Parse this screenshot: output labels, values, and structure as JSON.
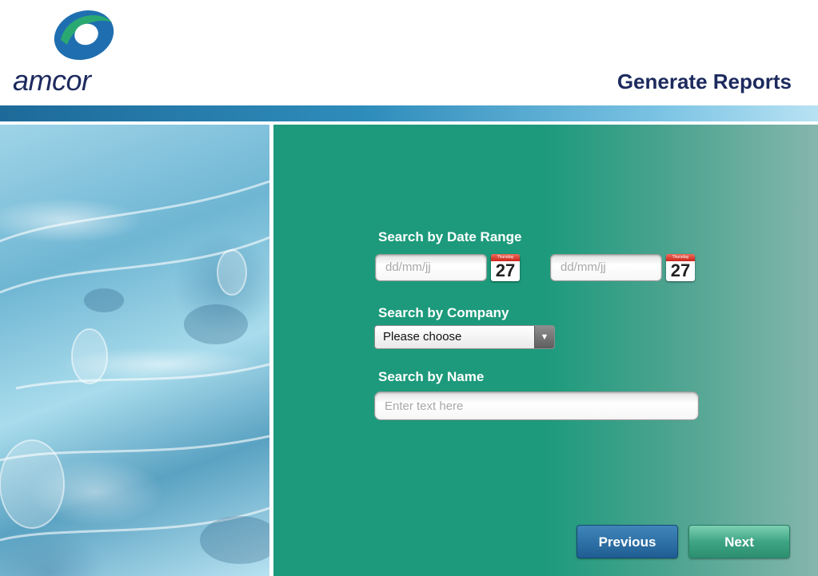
{
  "brand": {
    "name": "amcor",
    "colors": {
      "navy": "#1c2a5e",
      "green": "#2aa872",
      "blue": "#1f6fb0",
      "panel": "#1d9a7c"
    }
  },
  "header": {
    "title": "Generate Reports"
  },
  "form": {
    "date_range": {
      "label": "Search by Date Range",
      "from": {
        "placeholder": "dd/mm/jj",
        "calendar_day": "27",
        "calendar_weekday": "Thursday"
      },
      "to": {
        "placeholder": "dd/mm/jj",
        "calendar_day": "27",
        "calendar_weekday": "Thursday"
      }
    },
    "company": {
      "label": "Search by Company",
      "selected": "Please choose",
      "arrow": "▼"
    },
    "name": {
      "label": "Search by Name",
      "placeholder": "Enter text here"
    }
  },
  "footer": {
    "previous_label": "Previous",
    "next_label": "Next"
  }
}
